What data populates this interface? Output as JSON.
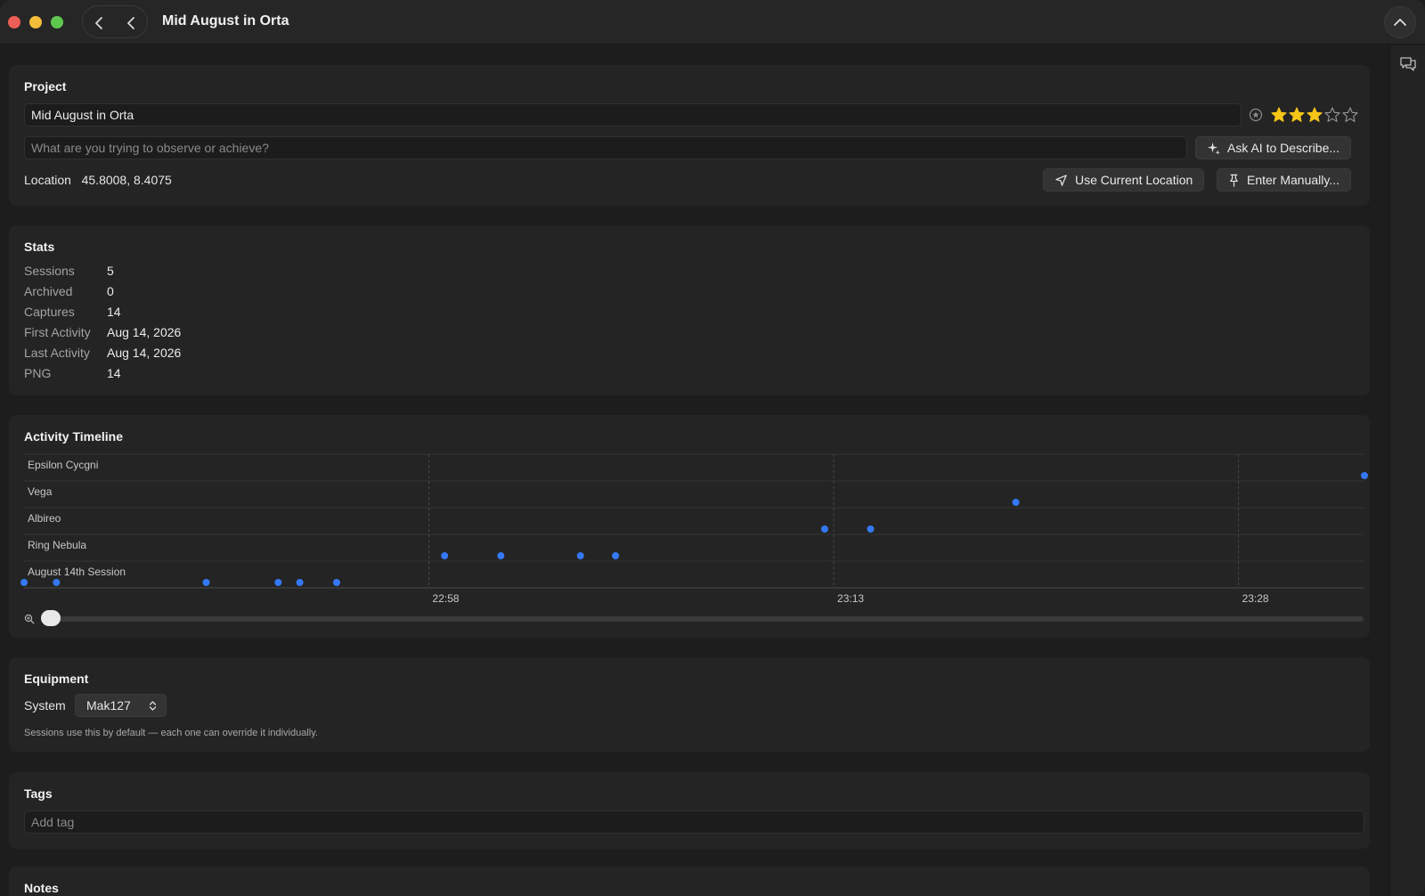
{
  "window": {
    "title": "Mid August in Orta"
  },
  "project": {
    "heading": "Project",
    "name_value": "Mid August in Orta",
    "goal_placeholder": "What are you trying to observe or achieve?",
    "ask_ai_label": "Ask AI to Describe...",
    "rating": 3,
    "rating_max": 5,
    "location_label": "Location",
    "location_value": "45.8008, 8.4075",
    "use_location_label": "Use Current Location",
    "enter_manually_label": "Enter Manually..."
  },
  "stats": {
    "heading": "Stats",
    "rows": [
      {
        "label": "Sessions",
        "value": "5"
      },
      {
        "label": "Archived",
        "value": "0"
      },
      {
        "label": "Captures",
        "value": "14"
      },
      {
        "label": "First Activity",
        "value": "Aug 14, 2026"
      },
      {
        "label": "Last Activity",
        "value": "Aug 14, 2026"
      },
      {
        "label": "PNG",
        "value": "14"
      }
    ]
  },
  "timeline": {
    "heading": "Activity Timeline",
    "zoom_level": 0
  },
  "chart_data": {
    "type": "scatter",
    "title": "Activity Timeline",
    "x_unit": "time (HH:MM)",
    "categories": [
      "Epsilon Cycgni",
      "Vega",
      "Albireo",
      "Ring Nebula",
      "August 14th Session"
    ],
    "x_ticks": [
      "22:58",
      "23:13",
      "23:28"
    ],
    "xlim": [
      "22:43:00",
      "23:32:40"
    ],
    "series": [
      {
        "category": "August 14th Session",
        "x": [
          "22:43:00",
          "22:44:12",
          "22:49:45",
          "22:52:25",
          "22:53:13",
          "22:54:35"
        ]
      },
      {
        "category": "Ring Nebula",
        "x": [
          "22:58:35",
          "23:00:40",
          "23:03:37",
          "23:04:55"
        ]
      },
      {
        "category": "Albireo",
        "x": [
          "23:12:40",
          "23:14:22"
        ]
      },
      {
        "category": "Vega",
        "x": [
          "23:19:45"
        ]
      },
      {
        "category": "Epsilon Cycgni",
        "x": [
          "23:32:40"
        ]
      }
    ],
    "point_color": "#3478f6",
    "grid": true
  },
  "equipment": {
    "heading": "Equipment",
    "system_label": "System",
    "system_value": "Mak127",
    "hint": "Sessions use this by default — each one can override it individually."
  },
  "tags": {
    "heading": "Tags",
    "placeholder": "Add tag"
  },
  "notes": {
    "heading": "Notes"
  },
  "colors": {
    "accent": "#3478f6",
    "star": "#f5c518"
  }
}
